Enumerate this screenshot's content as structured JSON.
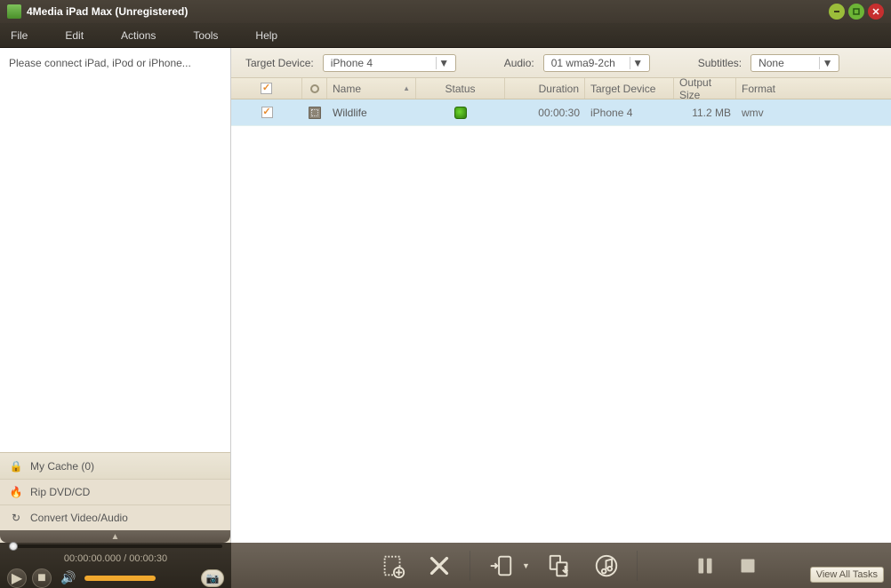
{
  "window": {
    "title": "4Media iPad Max (Unregistered)"
  },
  "menu": {
    "file": "File",
    "edit": "Edit",
    "actions": "Actions",
    "tools": "Tools",
    "help": "Help"
  },
  "sidebar": {
    "connect_prompt": "Please connect iPad, iPod or iPhone...",
    "my_cache": "My Cache (0)",
    "rip": "Rip DVD/CD",
    "convert": "Convert Video/Audio"
  },
  "filters": {
    "target_device_label": "Target Device:",
    "target_device_value": "iPhone 4",
    "audio_label": "Audio:",
    "audio_value": "01 wma9-2ch",
    "subtitles_label": "Subtitles:",
    "subtitles_value": "None"
  },
  "table": {
    "headers": {
      "name": "Name",
      "status": "Status",
      "duration": "Duration",
      "target": "Target Device",
      "size": "Output Size",
      "format": "Format"
    },
    "rows": [
      {
        "checked": true,
        "name": "Wildlife",
        "duration": "00:00:30",
        "target": "iPhone 4",
        "size": "11.2 MB",
        "format": "wmv"
      }
    ]
  },
  "player": {
    "time": "00:00:00.000 / 00:00:30"
  },
  "footer": {
    "view_all": "View All Tasks"
  }
}
